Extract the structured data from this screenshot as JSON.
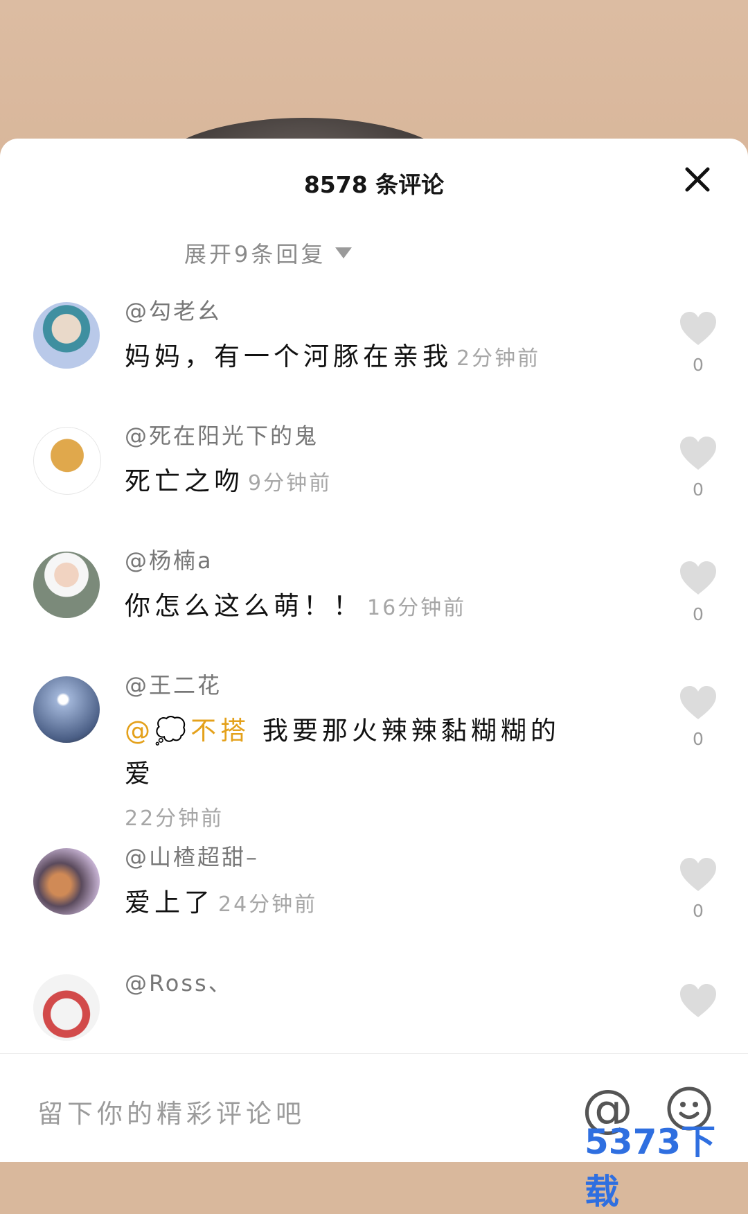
{
  "header": {
    "title": "8578 条评论"
  },
  "expand_replies": {
    "label": "展开9条回复"
  },
  "comments": [
    {
      "username": "@勾老幺",
      "text": "妈妈，有一个河豚在亲我",
      "time": "2分钟前",
      "likes": "0"
    },
    {
      "username": "@死在阳光下的鬼",
      "text": "死亡之吻",
      "time": "9分钟前",
      "likes": "0"
    },
    {
      "username": "@杨楠a",
      "text": "你怎么这么萌！！",
      "time": "16分钟前",
      "likes": "0"
    },
    {
      "username": "@王二花",
      "mention": "@💭不搭",
      "text": "我要那火辣辣黏糊糊的爱",
      "time": "22分钟前",
      "likes": "0"
    },
    {
      "username": "@山楂超甜–",
      "text": "爱上了",
      "time": "24分钟前",
      "likes": "0"
    },
    {
      "username": "@Ross、",
      "likes": ""
    }
  ],
  "input": {
    "placeholder": "留下你的精彩评论吧"
  },
  "watermark": "5373下载",
  "colors": {
    "mention": "#e4a11b",
    "watermark": "#2f6fe0"
  }
}
